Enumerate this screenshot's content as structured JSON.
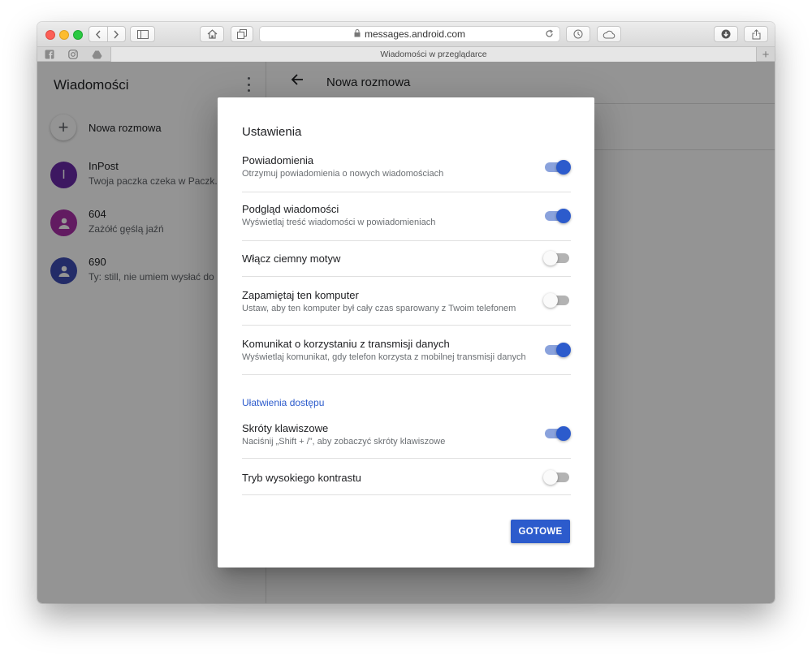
{
  "browser": {
    "url": "messages.android.com",
    "tab_title": "Wiadomości w przeglądarce"
  },
  "sidebar": {
    "title": "Wiadomości",
    "new_conversation": "Nowa rozmowa",
    "conversations": [
      {
        "name": "InPost",
        "avatar_letter": "I",
        "avatar_color": "#6a2aa8",
        "preview": "Twoja paczka czeka w Paczk..."
      },
      {
        "name": "604",
        "avatar_letter": "",
        "avatar_color": "#a92fa8",
        "preview": "Zażółć gęślą jaźń"
      },
      {
        "name": "690",
        "avatar_letter": "",
        "avatar_color": "#3d4db3",
        "preview": "Ty: still, nie umiem wysłać do ..."
      }
    ]
  },
  "main": {
    "title": "Nowa rozmowa"
  },
  "dialog": {
    "title": "Ustawienia",
    "settings": [
      {
        "label": "Powiadomienia",
        "description": "Otrzymuj powiadomienia o nowych wiadomościach",
        "enabled": true
      },
      {
        "label": "Podgląd wiadomości",
        "description": "Wyświetlaj treść wiadomości w powiadomieniach",
        "enabled": true
      },
      {
        "label": "Włącz ciemny motyw",
        "description": "",
        "enabled": false
      },
      {
        "label": "Zapamiętaj ten komputer",
        "description": "Ustaw, aby ten komputer był cały czas sparowany z Twoim telefonem",
        "enabled": false
      },
      {
        "label": "Komunikat o korzystaniu z transmisji danych",
        "description": "Wyświetlaj komunikat, gdy telefon korzysta z mobilnej transmisji danych",
        "enabled": true
      }
    ],
    "accessibility_header": "Ułatwienia dostępu",
    "accessibility_settings": [
      {
        "label": "Skróty klawiszowe",
        "description": "Naciśnij „Shift + /”, aby zobaczyć skróty klawiszowe",
        "enabled": true
      },
      {
        "label": "Tryb wysokiego kontrastu",
        "description": "",
        "enabled": false
      }
    ],
    "done_label": "GOTOWE"
  },
  "colors": {
    "accent": "#2c5bcc",
    "toggle_on_track": "#8aa2dc",
    "toggle_off_track": "#b3b3b3"
  }
}
